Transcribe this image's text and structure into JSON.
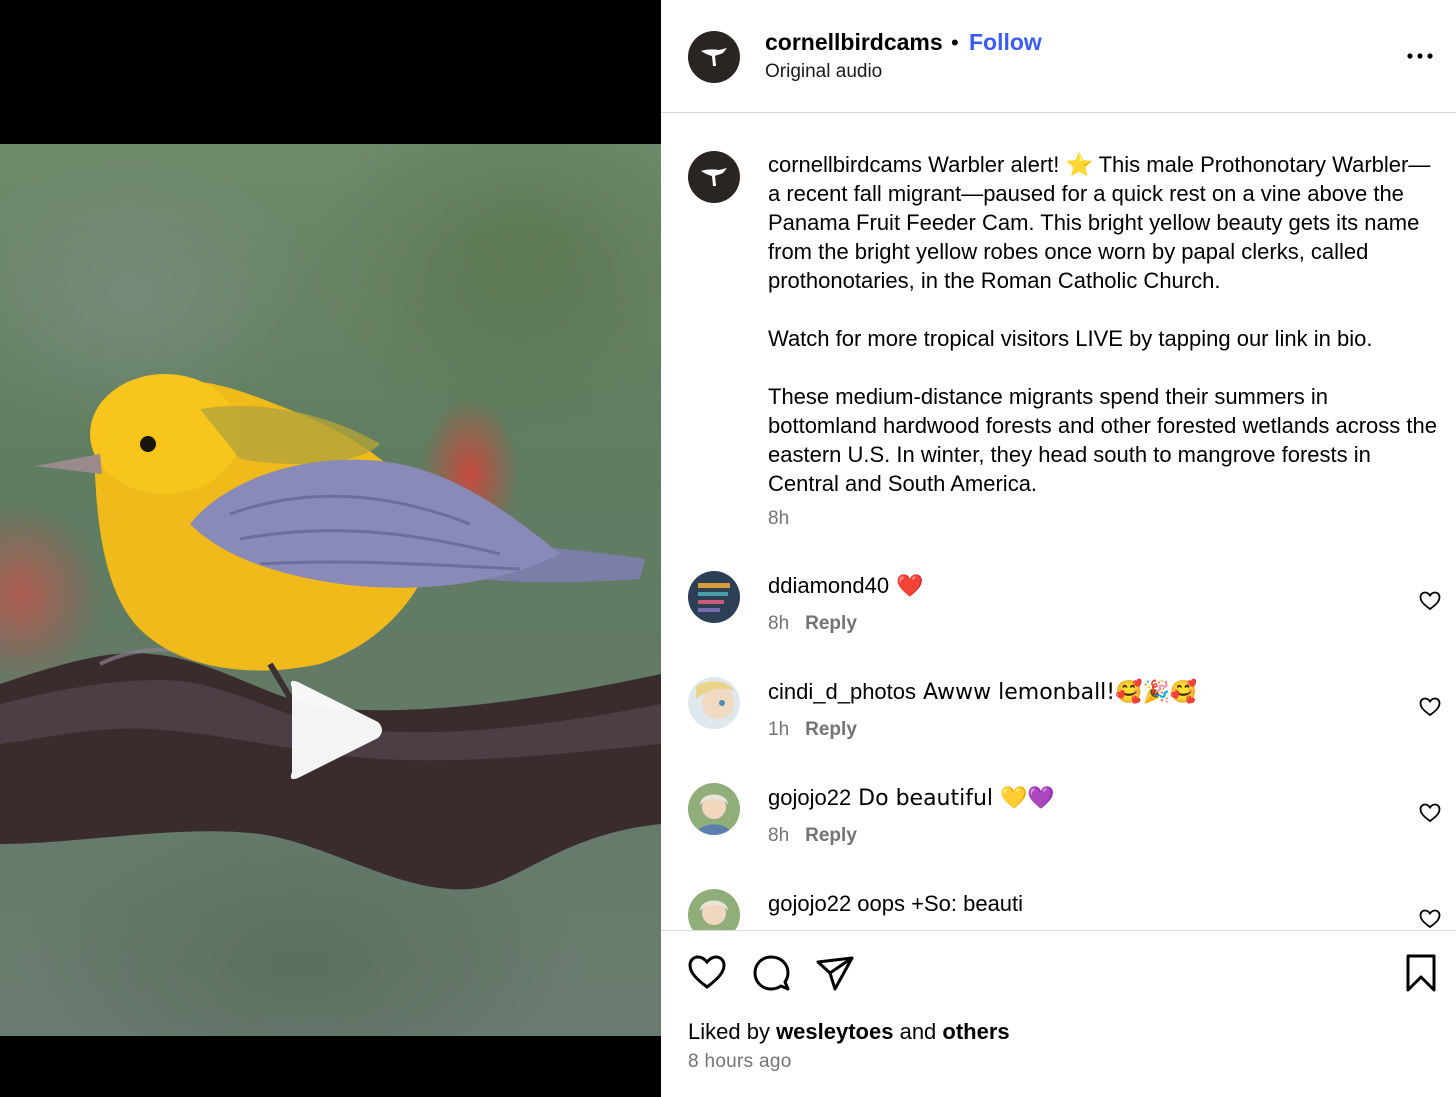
{
  "post": {
    "username": "cornellbirdcams",
    "separator": "•",
    "follow_label": "Follow",
    "audio_label": "Original audio"
  },
  "caption": {
    "username": "cornellbirdcams",
    "text": " Warbler alert! ⭐ This male Prothonotary Warbler—a recent fall migrant—paused for a quick rest on a vine above the Panama Fruit Feeder Cam. This bright yellow beauty gets its name from the bright yellow robes once worn by papal clerks, called prothonotaries, in the Roman Catholic Church.\n\nWatch for more tropical visitors LIVE by tapping our link in bio.\n\nThese medium-distance migrants spend their summers in bottomland hardwood forests and other forested wetlands across the eastern U.S. In winter, they head south to mangrove forests in Central and South America.",
    "time": "8h"
  },
  "comments": [
    {
      "username": "ddiamond40",
      "text": " ❤️",
      "time": "8h",
      "reply": "Reply"
    },
    {
      "username": "cindi_d_photos",
      "text": " Awww lemonball!🥰🎉🥰",
      "time": "1h",
      "reply": "Reply"
    },
    {
      "username": "gojojo22",
      "text": " Do beautiful 💛💜",
      "time": "8h",
      "reply": "Reply"
    },
    {
      "username": "gojojo22",
      "text": " oops +So: beauti",
      "time": "",
      "reply": ""
    }
  ],
  "footer": {
    "liked_prefix": "Liked by ",
    "liked_user": "wesleytoes",
    "liked_and": " and ",
    "liked_others": "others",
    "time_ago": "8 hours ago"
  },
  "icons": [
    "play-icon",
    "more-icon",
    "heart-icon",
    "comment-icon",
    "share-icon",
    "bookmark-icon"
  ],
  "colors": {
    "follow": "#3b5bf6",
    "secondary_text": "#737373",
    "divider": "#dbdbdb"
  }
}
